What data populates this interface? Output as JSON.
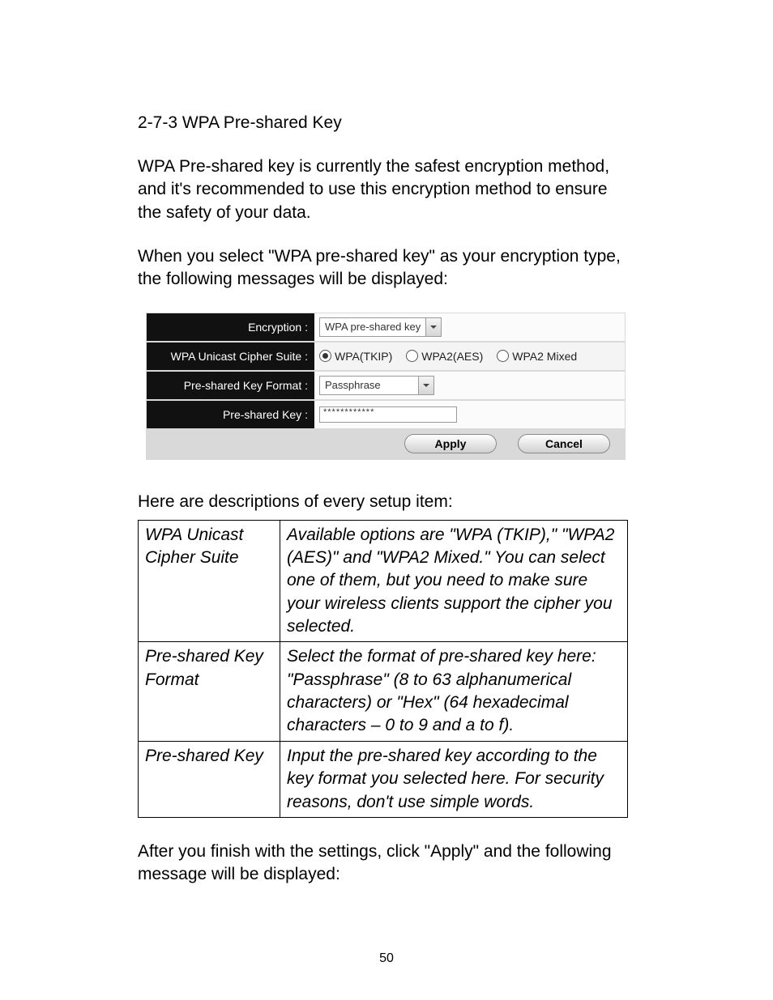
{
  "heading": "2-7-3 WPA Pre-shared Key",
  "para1": "WPA Pre-shared key is currently the safest encryption method, and it's recommended to use this encryption method to ensure the safety of your data.",
  "para2": "When you select \"WPA pre-shared key\" as your encryption type, the following messages will be displayed:",
  "panel": {
    "rows": {
      "encryption": {
        "label": "Encryption :",
        "select_value": "WPA pre-shared key"
      },
      "cipher": {
        "label": "WPA Unicast Cipher Suite :",
        "options": [
          {
            "label": "WPA(TKIP)",
            "checked": true
          },
          {
            "label": "WPA2(AES)",
            "checked": false
          },
          {
            "label": "WPA2 Mixed",
            "checked": false
          }
        ]
      },
      "keyformat": {
        "label": "Pre-shared Key Format :",
        "select_value": "Passphrase"
      },
      "key": {
        "label": "Pre-shared Key :",
        "input_value": "************"
      }
    },
    "buttons": {
      "apply": "Apply",
      "cancel": "Cancel"
    }
  },
  "desc_intro": "Here are descriptions of every setup item:",
  "desc_table": [
    {
      "term": "WPA Unicast Cipher Suite",
      "def": "Available options are \"WPA (TKIP),\" \"WPA2 (AES)\" and \"WPA2 Mixed.\" You can select one of them, but you need to make sure your wireless clients support the cipher you selected."
    },
    {
      "term": "Pre-shared Key Format",
      "def": "Select the format of pre-shared key here: \"Passphrase\" (8 to 63 alphanumerical characters) or \"Hex\" (64 hexadecimal characters – 0 to 9 and a to f)."
    },
    {
      "term": "Pre-shared Key",
      "def": "Input the pre-shared key according to the key format you selected here. For security reasons, don't use simple words."
    }
  ],
  "after": "After you finish with the settings, click \"Apply\" and the following message will be displayed:",
  "page_number": "50"
}
